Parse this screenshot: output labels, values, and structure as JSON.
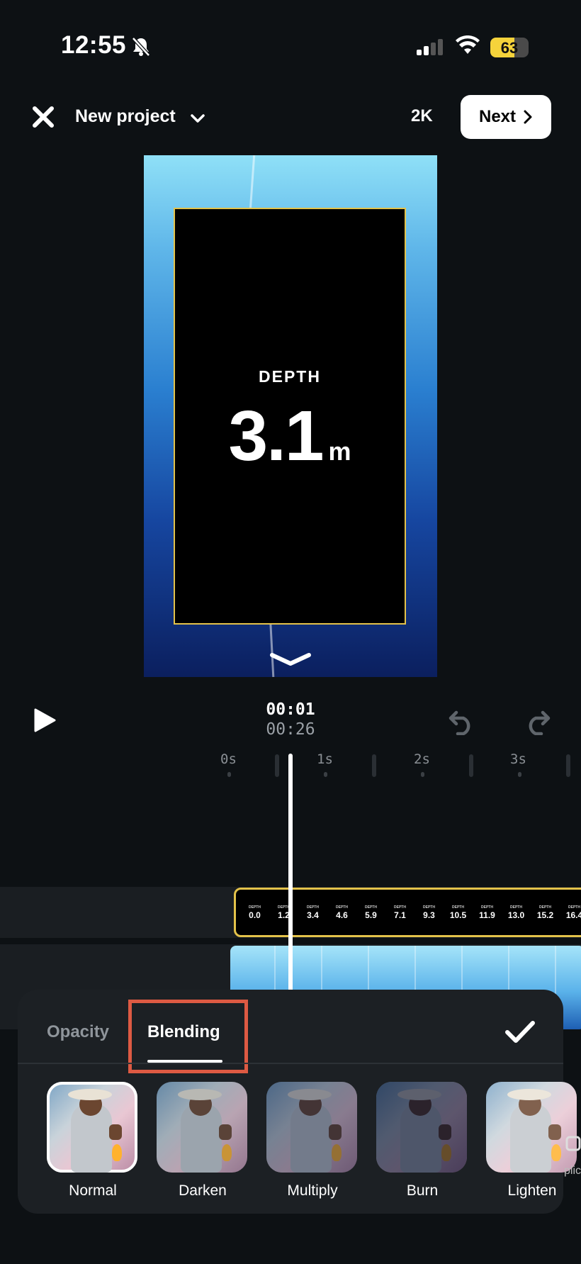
{
  "status": {
    "time": "12:55",
    "battery_percent": 63
  },
  "header": {
    "project_title": "New project",
    "resolution": "2K",
    "next_label": "Next"
  },
  "preview": {
    "depth_label": "DEPTH",
    "depth_value": "3.1",
    "depth_unit": "m"
  },
  "transport": {
    "current_time": "00:01",
    "total_time": "00:26"
  },
  "ruler": {
    "labels": [
      "0s",
      "1s",
      "2s",
      "3s"
    ]
  },
  "depth_track": {
    "label": "DEPTH",
    "values": [
      "0.0",
      "1.2",
      "3.4",
      "4.6",
      "5.9",
      "7.1",
      "9.3",
      "10.5",
      "11.9",
      "13.0",
      "15.2",
      "16.4"
    ]
  },
  "panel": {
    "tabs": [
      {
        "label": "Opacity",
        "active": false
      },
      {
        "label": "Blending",
        "active": true
      }
    ],
    "blend_modes": [
      {
        "label": "Normal",
        "selected": true
      },
      {
        "label": "Darken",
        "selected": false
      },
      {
        "label": "Multiply",
        "selected": false
      },
      {
        "label": "Burn",
        "selected": false
      },
      {
        "label": "Lighten",
        "selected": false
      }
    ],
    "edge_hint_text": "plic"
  },
  "colors": {
    "accent_yellow": "#e3c24a",
    "highlight_red": "#dd5a43",
    "background": "#0d1114"
  }
}
